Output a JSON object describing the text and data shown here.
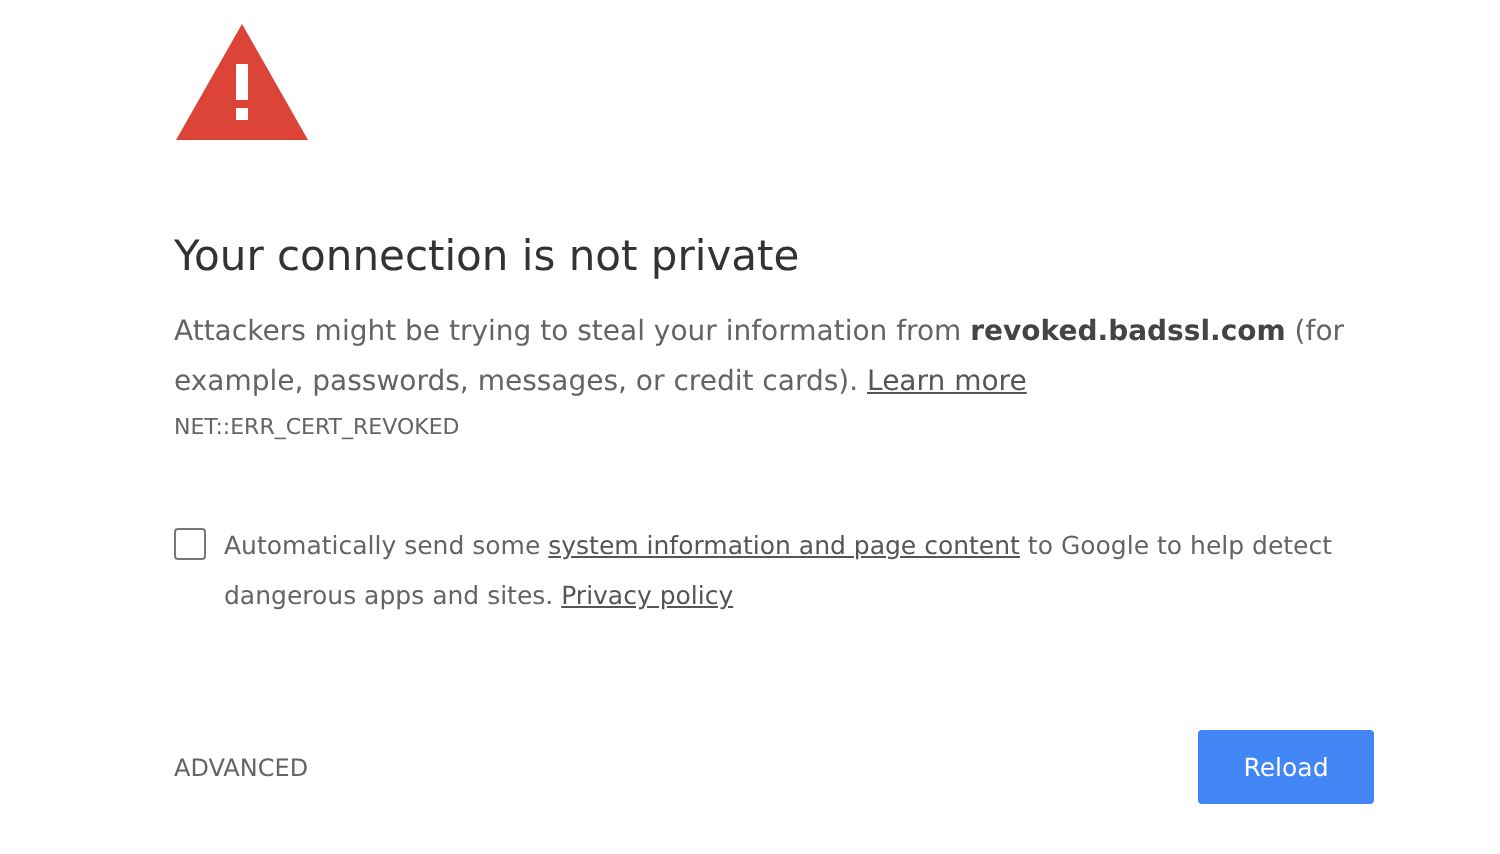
{
  "heading": "Your connection is not private",
  "message": [
    {
      "kind": "text",
      "text": "Attackers might be trying to steal your information from **revoked.badssl.com** (for example, passwords, messages, or credit cards). "
    },
    {
      "kind": "link",
      "text": "Learn more"
    }
  ],
  "error_code": "NET::ERR_CERT_REVOKED",
  "report": {
    "checked": false,
    "segments": [
      {
        "kind": "text",
        "text": "Automatically send some "
      },
      {
        "kind": "link",
        "text": "system information and page content"
      },
      {
        "kind": "text",
        "text": " to Google to help detect dangerous apps and sites. "
      },
      {
        "kind": "link",
        "text": "Privacy policy"
      }
    ]
  },
  "advanced_button": "ADVANCED",
  "reload_button": "Reload"
}
